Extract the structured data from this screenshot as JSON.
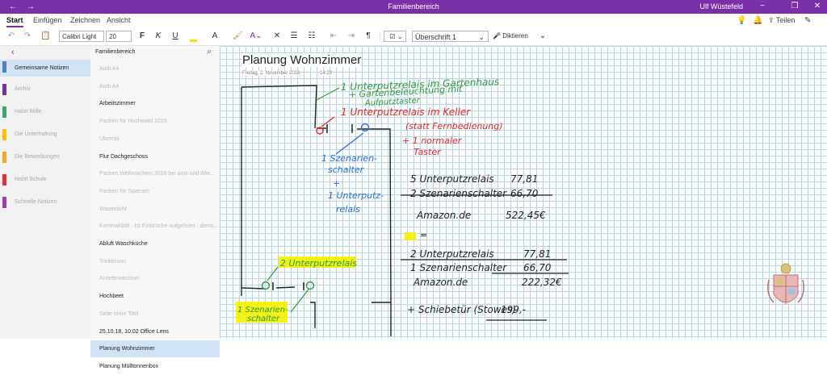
{
  "window": {
    "title": "Familienbereich",
    "user": "Ulf Wüstefeld"
  },
  "ribbon_tabs": [
    "Start",
    "Einfügen",
    "Zeichnen",
    "Ansicht"
  ],
  "share_label": "Teilen",
  "toolbar": {
    "font": "Calibri Light",
    "size": "20",
    "style": "Überschrift 1",
    "dictate": "Diktieren",
    "bold": "F",
    "italic": "K",
    "underline": "U"
  },
  "notebook": {
    "name": "Familienbereich"
  },
  "sections": [
    {
      "label": "Gemeinsame Notizen",
      "color": "#4f81bd"
    },
    {
      "label": "Archiv",
      "color": "#7030a0"
    },
    {
      "label": "Habit Wille",
      "color": "#3da86a"
    },
    {
      "label": "Die Unterhaltung",
      "color": "#ffbf00"
    },
    {
      "label": "Die Bewerbungen",
      "color": "#f4a42a"
    },
    {
      "label": "Habit Schule",
      "color": "#e0303a"
    },
    {
      "label": "Schnelle Notizen",
      "color": "#9b3fb4"
    }
  ],
  "pages": [
    {
      "label": "Audi A4",
      "state": "faded"
    },
    {
      "label": "Audi A4",
      "state": "faded"
    },
    {
      "label": "Arbeitszimmer",
      "state": "clear"
    },
    {
      "label": "Packen für Hochwald 2015",
      "state": "faded"
    },
    {
      "label": "Übernbi",
      "state": "faded"
    },
    {
      "label": "Flur Dachgeschoss",
      "state": "clear"
    },
    {
      "label": "Packen Weihnachten 2016 bei anis und Wie...",
      "state": "faded"
    },
    {
      "label": "Packen für Sparnen",
      "state": "faded"
    },
    {
      "label": "Wasenlicht",
      "state": "faded"
    },
    {
      "label": "Kommahbitt · Ist Einbrüche aufgelistet · dieno...",
      "state": "faded"
    },
    {
      "label": "Abluft Waschküche",
      "state": "clear"
    },
    {
      "label": "Trinkbrunn",
      "state": "faded"
    },
    {
      "label": "Anlieferwechsel",
      "state": "faded"
    },
    {
      "label": "Hochbeet",
      "state": "clear"
    },
    {
      "label": "Seite ohne Titel",
      "state": "faded"
    },
    {
      "label": "25.10.18, 10:02 Office Lens",
      "state": "clear"
    },
    {
      "label": "Planung Wohnzimmer",
      "state": "selected"
    },
    {
      "label": "Planung Mülltonnenbox",
      "state": "clear"
    }
  ],
  "page": {
    "title": "Planung Wohnzimmer",
    "date": "Freitag, 2. November 2018",
    "time": "14:29"
  },
  "ink_text": {
    "green1": "1 Unterputzrelais im Gartenhaus",
    "green2": "+ Gartenbeleuchtung mit",
    "green3": "Aufputztaster",
    "red1": "1 Unterputzrelais im Keller",
    "red2": "(statt Fernbedienung)",
    "red3": "+ 1 normaler",
    "red4": "Taster",
    "blue1": "1 Szenarien-",
    "blue2": "schalter",
    "blue3": "+",
    "blue4": "1 Unterputz-",
    "blue5": "relais",
    "row1a": "5 Unterputzrelais",
    "row1b": "77,81",
    "row2a": "2 Szenarienschalter",
    "row2b": "66,70",
    "row3a": "Amazon.de",
    "row3b": "522,45€",
    "eq": "=",
    "row4a": "2 Unterputzrelais",
    "row4b": "77,81",
    "row5a": "1 Szenarienschalter",
    "row5b": "66,70",
    "row6a": "Amazon.de",
    "row6b": "222,32€",
    "row7a": "+ Schiebetür (Stowes)",
    "row7b": "199,-",
    "hl1": "2 Unterputzrelais",
    "hl2a": "1 Szenarien-",
    "hl2b": "schalter"
  }
}
